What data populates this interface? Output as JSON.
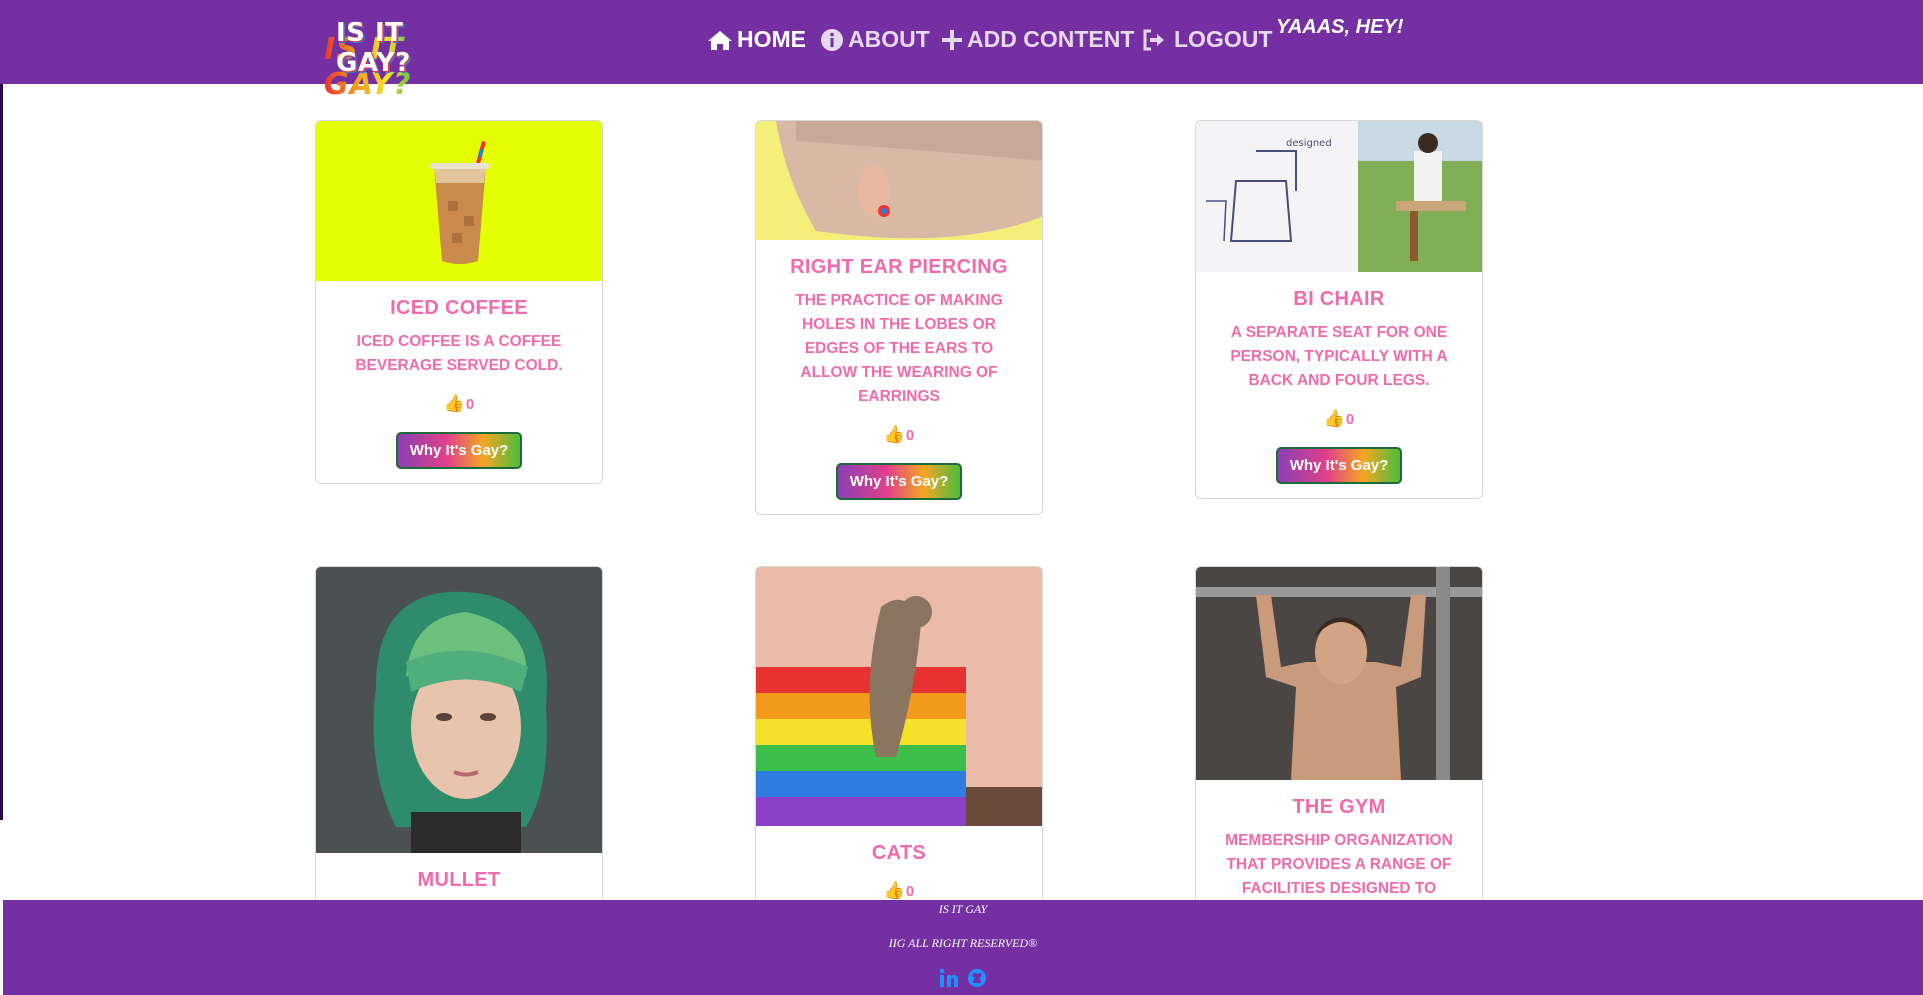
{
  "nav": {
    "logo_text": "IS IT GAY?",
    "home": "HOME",
    "about": "ABOUT",
    "add_content": "ADD CONTENT",
    "logout": "LOGOUT",
    "greeting": "YAAAS, HEY!"
  },
  "cards": [
    {
      "title": "ICED COFFEE",
      "description": "ICED COFFEE IS A COFFEE BEVERAGE SERVED COLD.",
      "likes": "0",
      "button": "Why It's Gay?"
    },
    {
      "title": "RIGHT EAR PIERCING",
      "description": "THE PRACTICE OF MAKING HOLES IN THE LOBES OR EDGES OF THE EARS TO ALLOW THE WEARING OF EARRINGS",
      "likes": "0",
      "button": "Why It's Gay?"
    },
    {
      "title": "BI CHAIR",
      "description": "A SEPARATE SEAT FOR ONE PERSON, TYPICALLY WITH A BACK AND FOUR LEGS.",
      "likes": "0",
      "button": "Why It's Gay?"
    },
    {
      "title": "MULLET"
    },
    {
      "title": "CATS",
      "likes": "0"
    },
    {
      "title": "THE GYM",
      "description": "MEMBERSHIP ORGANIZATION THAT PROVIDES A RANGE OF FACILITIES DESIGNED TO"
    }
  ],
  "footer": {
    "line1": "IS IT GAY",
    "line2": "IIG ALL RIGHT RESERVED®",
    "icons": [
      "linkedin-icon",
      "github-icon"
    ]
  },
  "colors": {
    "brand_purple": "#7430a3",
    "card_text_pink": "#f06bae"
  }
}
